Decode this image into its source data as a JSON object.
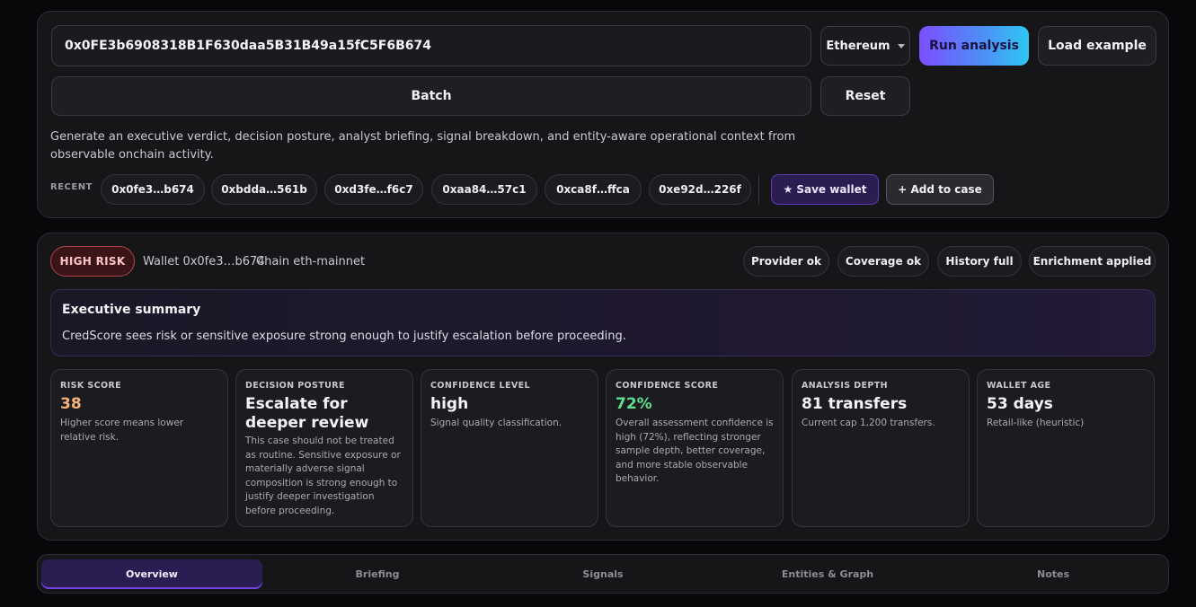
{
  "search": {
    "address_value": "0x0FE3b6908318B1F630daa5B31B49a15fC5F6B674",
    "chain_selected": "Ethereum",
    "run_label": "Run analysis",
    "load_example_label": "Load example",
    "batch_label": "Batch",
    "reset_label": "Reset",
    "description": "Generate an executive verdict, decision posture, analyst briefing, signal breakdown, and entity-aware operational context from observable onchain activity."
  },
  "recent": {
    "label": "RECENT",
    "items": [
      "0x0fe3…b674",
      "0xbdda…561b",
      "0xd3fe…f6c7",
      "0xaa84…57c1",
      "0xca8f…ffca",
      "0xe92d…226f"
    ],
    "save_wallet_label": "★ Save wallet",
    "add_to_case_label": "+ Add to case"
  },
  "result": {
    "risk_badge": "HIGH RISK",
    "wallet_text": "Wallet 0x0fe3…b674",
    "chain_text": "Chain eth-mainnet",
    "status_chips": [
      "Provider ok",
      "Coverage ok",
      "History full",
      "Enrichment applied"
    ],
    "summary_title": "Executive summary",
    "summary_text": "CredScore sees risk or sensitive exposure strong enough to justify escalation before proceeding.",
    "cards": [
      {
        "label": "RISK SCORE",
        "value": "38",
        "note": "Higher score means lower relative risk."
      },
      {
        "label": "DECISION POSTURE",
        "value": "Escalate for deeper review",
        "note": "This case should not be treated as routine. Sensitive exposure or materially adverse signal composition is strong enough to justify deeper investigation before proceeding."
      },
      {
        "label": "CONFIDENCE LEVEL",
        "value": "high",
        "note": "Signal quality classification."
      },
      {
        "label": "CONFIDENCE SCORE",
        "value": "72%",
        "note": "Overall assessment confidence is high (72%), reflecting stronger sample depth, better coverage, and more stable observable behavior."
      },
      {
        "label": "ANALYSIS DEPTH",
        "value": "81 transfers",
        "note": "Current cap 1,200 transfers."
      },
      {
        "label": "WALLET AGE",
        "value": "53 days",
        "note": "Retail-like (heuristic)"
      }
    ],
    "colors": {
      "risk_score": "#f4b27a",
      "confidence_score": "#5fe08f"
    }
  },
  "tabs": [
    "Overview",
    "Briefing",
    "Signals",
    "Entities & Graph",
    "Notes"
  ],
  "active_tab": "Overview"
}
